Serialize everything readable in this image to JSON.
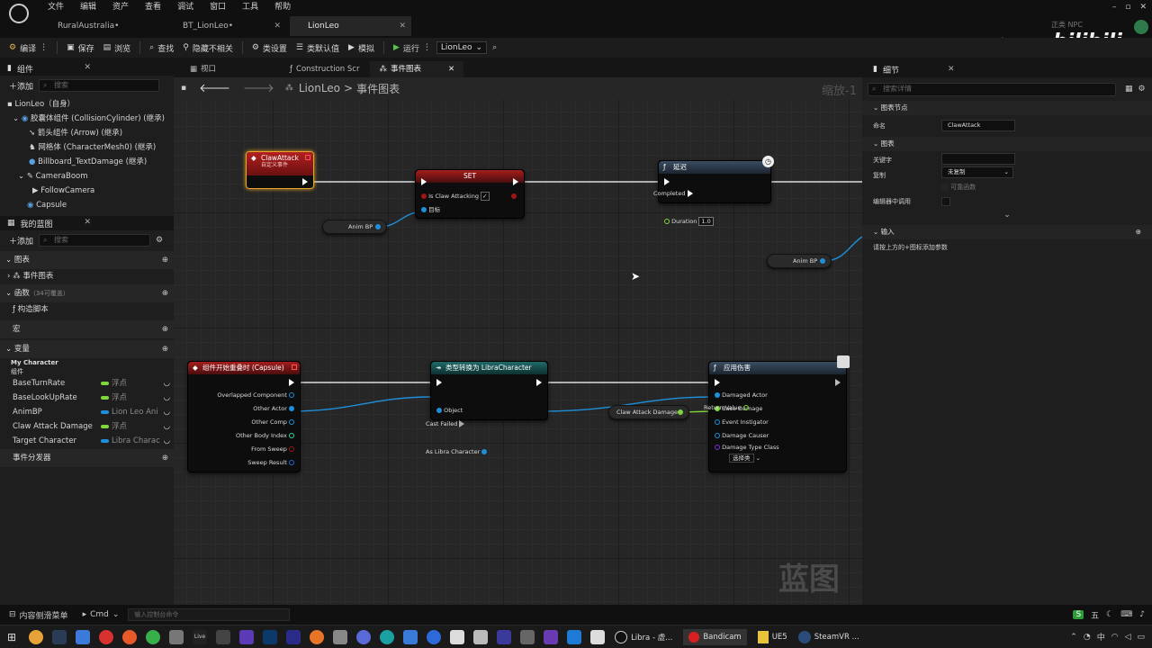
{
  "menu": [
    "文件",
    "编辑",
    "资产",
    "查看",
    "调试",
    "窗口",
    "工具",
    "帮助"
  ],
  "doc_tabs": [
    "RuralAustralia•",
    "BT_LionLeo•",
    "LionLeo"
  ],
  "watermark": {
    "brand": "tt脑思",
    "site": "bilibili",
    "npc": "NPC",
    "fade": "正类"
  },
  "toolbar": {
    "compile": "编译",
    "save": "保存",
    "browse": "浏览",
    "find": "查找",
    "hide": "隐藏不相关",
    "class_settings": "类设置",
    "class_defaults": "类默认值",
    "simulate": "模拟",
    "run": "运行",
    "target": "LionLeo"
  },
  "components": {
    "title": "组件",
    "add": "添加",
    "search": "搜索",
    "items": [
      "LionLeo（自身）",
      "胶囊体组件 (CollisionCylinder) (继承)",
      "箭头组件 (Arrow) (继承)",
      "网格体 (CharacterMesh0) (继承)",
      "Billboard_TextDamage (继承)",
      "CameraBoom",
      "FollowCamera",
      "Capsule"
    ]
  },
  "my_blueprint": {
    "title": "我的蓝图",
    "add": "添加",
    "search": "搜索",
    "graphs": "图表",
    "event_graph": "事件图表",
    "functions": "函数",
    "functions_count": "（34可覆盖）",
    "construct": "构造脚本",
    "macros": "宏",
    "variables": "变量",
    "var_category": "My Character",
    "var_sub": "组件",
    "vars": [
      {
        "name": "BaseTurnRate",
        "type": "浮点",
        "color": "#7fd63a"
      },
      {
        "name": "BaseLookUpRate",
        "type": "浮点",
        "color": "#7fd63a"
      },
      {
        "name": "AnimBP",
        "type": "Lion Leo Ani",
        "color": "#1f8fdc"
      },
      {
        "name": "Claw Attack Damage",
        "type": "浮点",
        "color": "#7fd63a"
      },
      {
        "name": "Target Character",
        "type": "Libra Charac",
        "color": "#1f8fdc"
      }
    ],
    "dispatchers": "事件分发器"
  },
  "graph_tabs": [
    "视口",
    "Construction Scr",
    "事件图表"
  ],
  "breadcrumb": {
    "root": "LionLeo",
    "sep": ">",
    "current": "事件图表",
    "zoom": "缩放-1"
  },
  "nodes": {
    "claw_attack": {
      "title": "ClawAttack",
      "sub": "自定义事件"
    },
    "set": {
      "title": "SET",
      "pin1": "Is Claw Attacking",
      "pin2": "目标"
    },
    "delay": {
      "title": "延迟",
      "completed": "Completed",
      "duration": "Duration",
      "duration_val": "1.0"
    },
    "anim_bp1": "Anim BP",
    "anim_bp2": "Anim BP",
    "overlap": {
      "title": "组件开始重叠时 (Capsule)",
      "pins": [
        "Overlapped Component",
        "Other Actor",
        "Other Comp",
        "Other Body Index",
        "From Sweep",
        "Sweep Result"
      ]
    },
    "cast": {
      "title": "类型转换为 LibraCharacter",
      "object": "Object",
      "failed": "Cast Failed",
      "as": "As Libra Character"
    },
    "damage_var": "Claw Attack Damage",
    "apply": {
      "title": "应用伤害",
      "pins": [
        "Damaged Actor",
        "Base Damage",
        "Event Instigator",
        "Damage Causer",
        "Damage Type Class"
      ],
      "ret": "Return Value",
      "select": "选择类"
    }
  },
  "graph_watermark": "蓝图",
  "details": {
    "title": "细节",
    "search": "搜索详情",
    "sec_node": "图表节点",
    "name_label": "命名",
    "name_val": "ClawAttack",
    "sec_graph": "图表",
    "keyword": "关键字",
    "replicate": "复制",
    "replicate_val": "未复制",
    "reliable": "可靠函数",
    "call_in_editor": "编辑器中调用",
    "sec_input": "输入",
    "input_hint": "请按上方的+图标添加参数"
  },
  "status": {
    "drawer": "内容侧滑菜单",
    "cmd": "Cmd",
    "console": "输入控制台命令"
  },
  "taskbar": {
    "libra": "Libra - 虚...",
    "bandicam": "Bandicam",
    "ue5": "UE5",
    "steamvr": "SteamVR ...",
    "ime": "五",
    "ime2": "中"
  }
}
